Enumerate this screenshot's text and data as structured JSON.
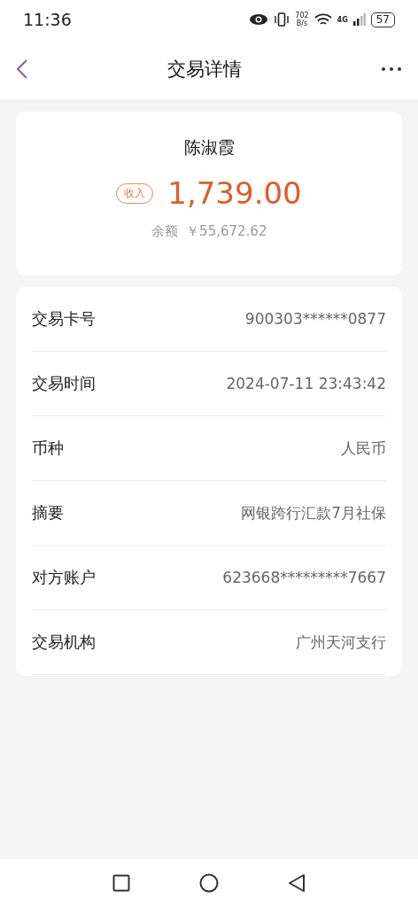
{
  "status_bar": {
    "time": "11:36",
    "speed_value": "702",
    "speed_unit": "B/s",
    "network": "4G",
    "battery": "57"
  },
  "header": {
    "title": "交易详情"
  },
  "summary": {
    "name": "陈淑霞",
    "tag": "收入",
    "amount": "1,739.00",
    "balance_label": "余额",
    "balance": "￥55,672.62"
  },
  "details": [
    {
      "label": "交易卡号",
      "value": "900303******0877"
    },
    {
      "label": "交易时间",
      "value": "2024-07-11 23:43:42"
    },
    {
      "label": "币种",
      "value": "人民币"
    },
    {
      "label": "摘要",
      "value": "网银跨行汇款7月社保"
    },
    {
      "label": "对方账户",
      "value": "623668*********7667"
    },
    {
      "label": "交易机构",
      "value": "广州天河支行"
    }
  ]
}
